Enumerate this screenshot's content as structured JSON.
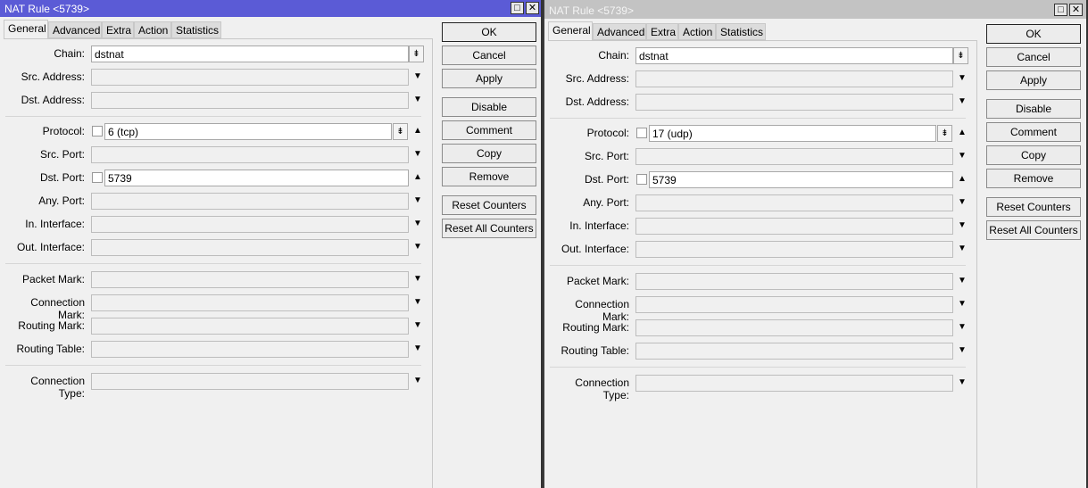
{
  "windows": [
    {
      "title": "NAT Rule <5739>",
      "state": "active",
      "tabs": [
        "General",
        "Advanced",
        "Extra",
        "Action",
        "Statistics"
      ],
      "selected_tab": "General",
      "fields": [
        {
          "label": "Chain:",
          "value": "dstnat",
          "kind": "select"
        },
        {
          "label": "Src. Address:",
          "value": "",
          "kind": "down"
        },
        {
          "label": "Dst. Address:",
          "value": "",
          "kind": "down"
        },
        {
          "label": "Protocol:",
          "value": "6 (tcp)",
          "kind": "chk-select"
        },
        {
          "label": "Src. Port:",
          "value": "",
          "kind": "down"
        },
        {
          "label": "Dst. Port:",
          "value": "5739",
          "kind": "chk-up"
        },
        {
          "label": "Any. Port:",
          "value": "",
          "kind": "down"
        },
        {
          "label": "In. Interface:",
          "value": "",
          "kind": "down"
        },
        {
          "label": "Out. Interface:",
          "value": "",
          "kind": "down"
        },
        {
          "label": "Packet Mark:",
          "value": "",
          "kind": "down"
        },
        {
          "label": "Connection Mark:",
          "value": "",
          "kind": "down"
        },
        {
          "label": "Routing Mark:",
          "value": "",
          "kind": "down"
        },
        {
          "label": "Routing Table:",
          "value": "",
          "kind": "down"
        },
        {
          "label": "Connection Type:",
          "value": "",
          "kind": "down"
        }
      ]
    },
    {
      "title": "NAT Rule <5739>",
      "state": "inactive",
      "tabs": [
        "General",
        "Advanced",
        "Extra",
        "Action",
        "Statistics"
      ],
      "selected_tab": "General",
      "fields": [
        {
          "label": "Chain:",
          "value": "dstnat",
          "kind": "select"
        },
        {
          "label": "Src. Address:",
          "value": "",
          "kind": "down"
        },
        {
          "label": "Dst. Address:",
          "value": "",
          "kind": "down"
        },
        {
          "label": "Protocol:",
          "value": "17 (udp)",
          "kind": "chk-select"
        },
        {
          "label": "Src. Port:",
          "value": "",
          "kind": "down"
        },
        {
          "label": "Dst. Port:",
          "value": "5739",
          "kind": "chk-up"
        },
        {
          "label": "Any. Port:",
          "value": "",
          "kind": "down"
        },
        {
          "label": "In. Interface:",
          "value": "",
          "kind": "down"
        },
        {
          "label": "Out. Interface:",
          "value": "",
          "kind": "down"
        },
        {
          "label": "Packet Mark:",
          "value": "",
          "kind": "down"
        },
        {
          "label": "Connection Mark:",
          "value": "",
          "kind": "down"
        },
        {
          "label": "Routing Mark:",
          "value": "",
          "kind": "down"
        },
        {
          "label": "Routing Table:",
          "value": "",
          "kind": "down"
        },
        {
          "label": "Connection Type:",
          "value": "",
          "kind": "down"
        }
      ]
    }
  ],
  "buttons": [
    "OK",
    "Cancel",
    "Apply",
    "Disable",
    "Comment",
    "Copy",
    "Remove",
    "Reset Counters",
    "Reset All Counters"
  ],
  "icons": {
    "maximize": "□",
    "close": "✕",
    "dropdown": "▼",
    "select": "⇟",
    "up": "▲"
  },
  "colors": {
    "active_title": "#5b5bd6",
    "inactive_title": "#c3c3c3"
  }
}
